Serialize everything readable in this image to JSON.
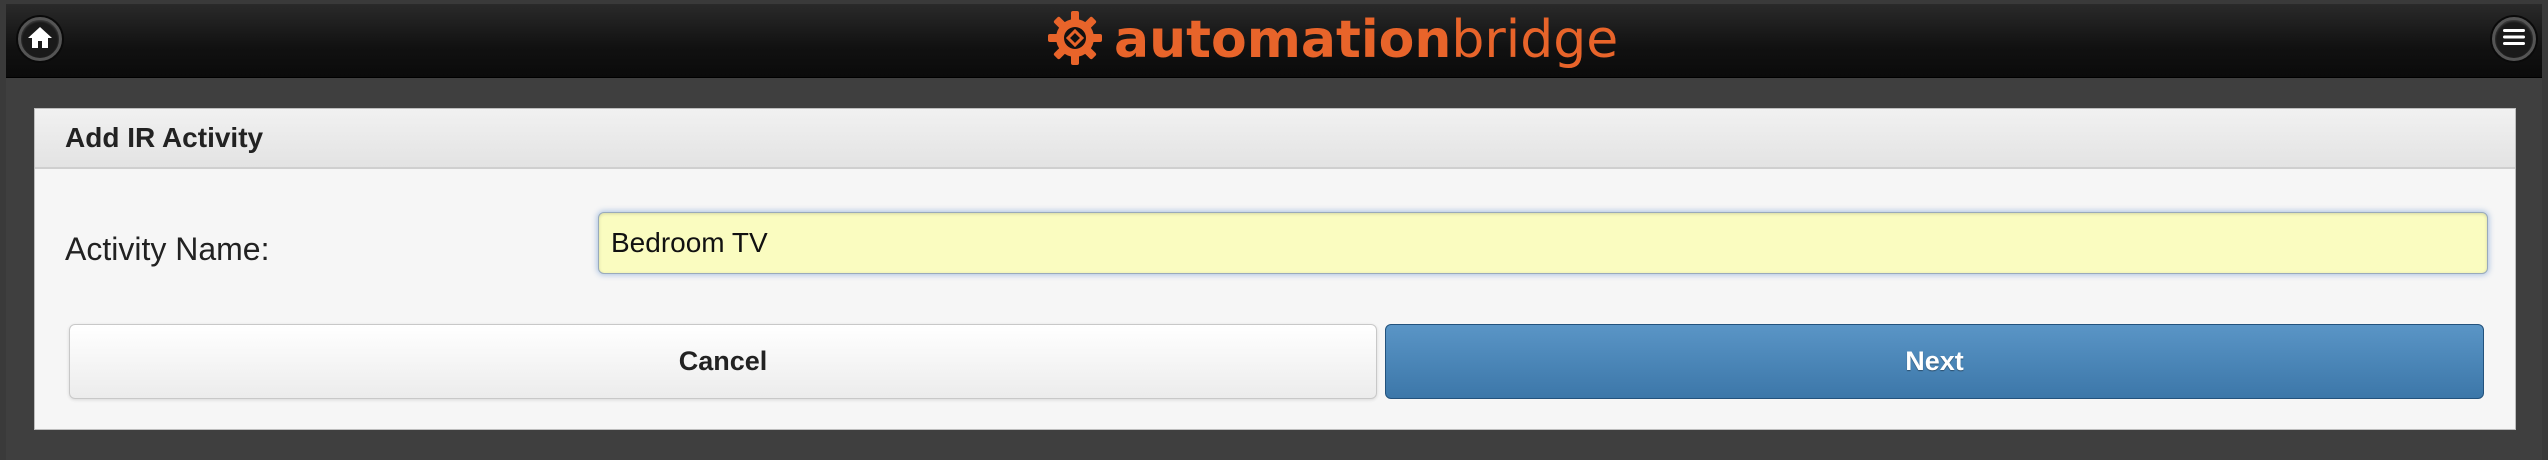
{
  "header": {
    "brand_bold": "automation",
    "brand_light": "bridge",
    "home_icon": "home-icon",
    "menu_icon": "menu-icon",
    "brand_color": "#e8642a"
  },
  "panel": {
    "title": "Add IR Activity",
    "activity_label": "Activity Name:",
    "activity_value": "Bedroom TV"
  },
  "actions": {
    "cancel_label": "Cancel",
    "next_label": "Next",
    "next_color": "#4a85b8"
  }
}
